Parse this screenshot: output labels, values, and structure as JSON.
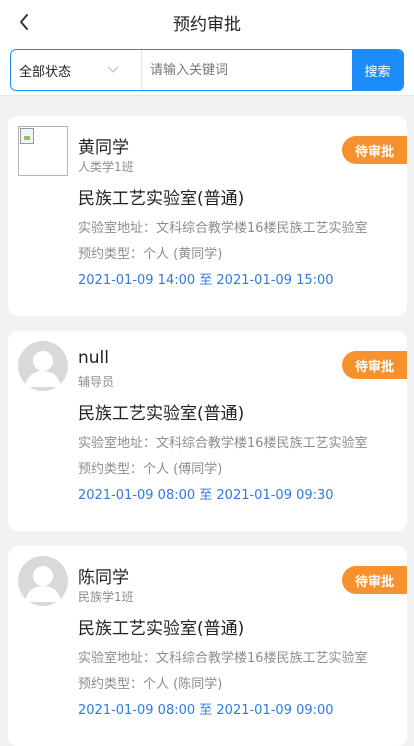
{
  "header": {
    "title": "预约审批"
  },
  "search": {
    "status_label": "全部状态",
    "placeholder": "请输入关键词",
    "button_label": "搜索"
  },
  "reservations": [
    {
      "name": "黄同学",
      "sub": "人类学1班",
      "status": "待审批",
      "room": "民族工艺实验室(普通)",
      "address": "实验室地址：文科综合教学楼16楼民族工艺实验室",
      "type": "预约类型：个人 (黄同学)",
      "time": "2021-01-09 14:00 至 2021-01-09 15:00"
    },
    {
      "name": "null",
      "sub": "辅导员",
      "status": "待审批",
      "room": "民族工艺实验室(普通)",
      "address": "实验室地址：文科综合教学楼16楼民族工艺实验室",
      "type": "预约类型：个人 (傅同学)",
      "time": "2021-01-09 08:00 至 2021-01-09 09:30"
    },
    {
      "name": "陈同学",
      "sub": "民族学1班",
      "status": "待审批",
      "room": "民族工艺实验室(普通)",
      "address": "实验室地址：文科综合教学楼16楼民族工艺实验室",
      "type": "预约类型：个人 (陈同学)",
      "time": "2021-01-09 08:00 至 2021-01-09 09:00"
    }
  ],
  "colors": {
    "accent": "#1d8cf8",
    "badge": "#f5922f",
    "time": "#2f7ae0",
    "background": "#f2f2f4"
  },
  "icons": {
    "back": "chevron-left-icon",
    "dropdown": "chevron-down-icon",
    "avatar_placeholder": "user-avatar-icon",
    "broken_image": "broken-image-icon"
  }
}
